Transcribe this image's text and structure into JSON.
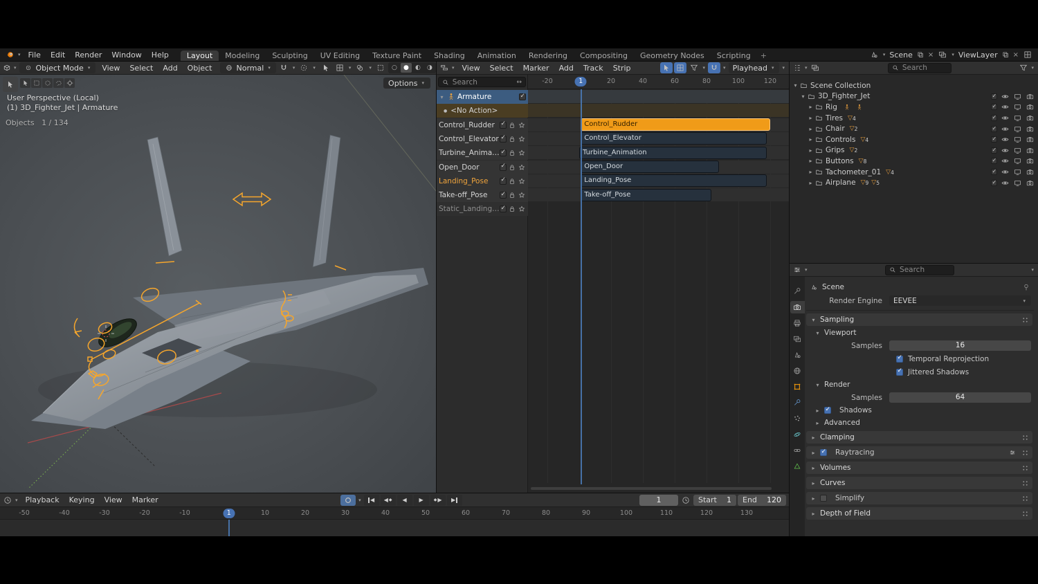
{
  "topbar": {
    "menus": [
      "File",
      "Edit",
      "Render",
      "Window",
      "Help"
    ],
    "tabs": [
      {
        "label": "Layout",
        "active": true
      },
      {
        "label": "Modeling"
      },
      {
        "label": "Sculpting"
      },
      {
        "label": "UV Editing"
      },
      {
        "label": "Texture Paint"
      },
      {
        "label": "Shading"
      },
      {
        "label": "Animation"
      },
      {
        "label": "Rendering"
      },
      {
        "label": "Compositing"
      },
      {
        "label": "Geometry Nodes"
      },
      {
        "label": "Scripting"
      }
    ],
    "add_tab_label": "+",
    "scene_name": "Scene",
    "viewlayer_name": "ViewLayer"
  },
  "viewport": {
    "mode": "Object Mode",
    "menus": [
      "View",
      "Select",
      "Add",
      "Object"
    ],
    "orientation": "Normal",
    "options_label": "Options",
    "overlay_line1": "User Perspective (Local)",
    "overlay_line2": "(1) 3D_Fighter_Jet | Armature",
    "stats_label": "Objects",
    "stats_value": "1 / 134"
  },
  "nla": {
    "menus": [
      "View",
      "Select",
      "Marker",
      "Add",
      "Track",
      "Strip"
    ],
    "playhead_label": "Playhead",
    "search_placeholder": "Search",
    "current_frame": "1",
    "ruler_ticks": [
      -20,
      20,
      40,
      60,
      80,
      100,
      120
    ],
    "tracks": [
      {
        "name": "Armature",
        "kind": "object",
        "selected": true
      },
      {
        "name": "<No Action>",
        "kind": "noaction"
      },
      {
        "name": "Control_Rudder",
        "kind": "strip-track"
      },
      {
        "name": "Control_Elevator",
        "kind": "strip-track"
      },
      {
        "name": "Turbine_Animation",
        "kind": "strip-track"
      },
      {
        "name": "Open_Door",
        "kind": "strip-track"
      },
      {
        "name": "Landing_Pose",
        "kind": "strip-track",
        "highlight": true
      },
      {
        "name": "Take-off_Pose",
        "kind": "strip-track"
      },
      {
        "name": "Static_Landing_Pos",
        "kind": "strip-track",
        "dimmed": true
      }
    ],
    "strips": [
      {
        "label": "Control_Rudder",
        "row": 2,
        "start": 1,
        "end": 120,
        "selected": true
      },
      {
        "label": "Control_Elevator",
        "row": 3,
        "start": 1,
        "end": 118
      },
      {
        "label": "Turbine_Animation",
        "row": 4,
        "start": 0,
        "end": 118
      },
      {
        "label": "Open_Door",
        "row": 5,
        "start": 1,
        "end": 88
      },
      {
        "label": "Landing_Pose",
        "row": 6,
        "start": 1,
        "end": 118
      },
      {
        "label": "Take-off_Pose",
        "row": 7,
        "start": 1,
        "end": 83
      }
    ]
  },
  "outliner": {
    "search_placeholder": "Search",
    "rows": [
      {
        "name": "Scene Collection",
        "level": 0,
        "arrow": "down",
        "toggles": false,
        "badges": []
      },
      {
        "name": "3D_Fighter_Jet",
        "level": 1,
        "arrow": "down",
        "toggles": true,
        "badges": []
      },
      {
        "name": "Rig",
        "level": 2,
        "arrow": "right",
        "toggles": true,
        "badges": [
          {
            "icon": "armature"
          },
          {
            "icon": "pose"
          }
        ]
      },
      {
        "name": "Tires",
        "level": 2,
        "arrow": "right",
        "toggles": true,
        "badges": [
          {
            "icon": "mesh",
            "count": "4"
          }
        ]
      },
      {
        "name": "Chair",
        "level": 2,
        "arrow": "right",
        "toggles": true,
        "badges": [
          {
            "icon": "mesh",
            "count": "2"
          }
        ]
      },
      {
        "name": "Controls",
        "level": 2,
        "arrow": "right",
        "toggles": true,
        "badges": [
          {
            "icon": "mesh",
            "count": "4"
          }
        ]
      },
      {
        "name": "Grips",
        "level": 2,
        "arrow": "right",
        "toggles": true,
        "badges": [
          {
            "icon": "mesh",
            "count": "2"
          }
        ]
      },
      {
        "name": "Buttons",
        "level": 2,
        "arrow": "right",
        "toggles": true,
        "badges": [
          {
            "icon": "mesh",
            "count": "8"
          }
        ]
      },
      {
        "name": "Tachometer_01",
        "level": 2,
        "arrow": "right",
        "toggles": true,
        "badges": [
          {
            "icon": "mesh",
            "count": "4"
          }
        ]
      },
      {
        "name": "Airplane",
        "level": 2,
        "arrow": "right",
        "toggles": true,
        "badges": [
          {
            "icon": "mesh",
            "count": "9"
          },
          {
            "icon": "mesh",
            "count": "5"
          }
        ]
      }
    ]
  },
  "properties": {
    "search_placeholder": "Search",
    "tabs": [
      "tool",
      "render",
      "output",
      "view-layer",
      "scene",
      "world",
      "object",
      "modifiers",
      "particles",
      "physics",
      "constraints",
      "data"
    ],
    "active_tab": "render",
    "breadcrumb": "Scene",
    "render_engine_label": "Render Engine",
    "render_engine_value": "EEVEE",
    "sampling_title": "Sampling",
    "viewport_title": "Viewport",
    "samples_label": "Samples",
    "viewport_samples": "16",
    "temporal_label": "Temporal Reprojection",
    "jittered_label": "Jittered Shadows",
    "render_title": "Render",
    "render_samples": "64",
    "shadows_label": "Shadows",
    "advanced_label": "Advanced",
    "clamping_label": "Clamping",
    "raytracing_label": "Raytracing",
    "volumes_label": "Volumes",
    "curves_label": "Curves",
    "simplify_label": "Simplify",
    "dof_label": "Depth of Field"
  },
  "timeline": {
    "menus": [
      "Playback",
      "Keying",
      "View",
      "Marker"
    ],
    "current_frame": "1",
    "frame_field": "1",
    "start_label": "Start",
    "start_value": "1",
    "end_label": "End",
    "end_value": "120",
    "ruler_ticks": [
      -50,
      -40,
      -30,
      -20,
      -10,
      10,
      20,
      30,
      40,
      50,
      60,
      70,
      80,
      90,
      100,
      110,
      120,
      130
    ]
  },
  "colors": {
    "accent_orange": "#e8930c",
    "accent_blue": "#4772b3",
    "selected_strip": "#f09b18",
    "strip_dark": "#26313d"
  }
}
